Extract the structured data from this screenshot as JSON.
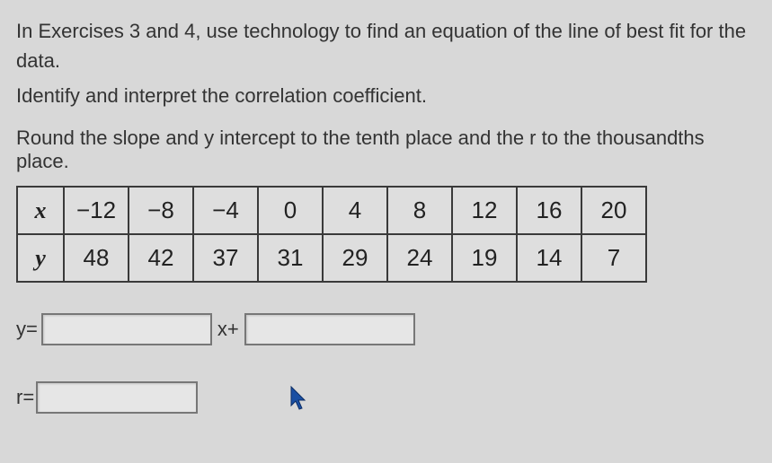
{
  "instructions": {
    "line1": "In Exercises 3 and 4, use technology to find an equation of the line of best fit for the data.",
    "line2": "Identify and interpret the correlation coefficient.",
    "rounding": "Round the slope and y intercept to the tenth place and the r to the thousandths place."
  },
  "table": {
    "rowLabels": {
      "x": "x",
      "y": "y"
    },
    "x": [
      "−12",
      "−8",
      "−4",
      "0",
      "4",
      "8",
      "12",
      "16",
      "20"
    ],
    "y": [
      "48",
      "42",
      "37",
      "31",
      "29",
      "24",
      "19",
      "14",
      "7"
    ]
  },
  "equation": {
    "yPrefix": "y=",
    "mid": "x+",
    "slopeValue": "",
    "interceptValue": ""
  },
  "correlation": {
    "prefix": "r=",
    "value": ""
  },
  "chart_data": {
    "type": "table",
    "title": "Data set for line of best fit",
    "columns": [
      "x",
      "y"
    ],
    "rows": [
      {
        "x": -12,
        "y": 48
      },
      {
        "x": -8,
        "y": 42
      },
      {
        "x": -4,
        "y": 37
      },
      {
        "x": 0,
        "y": 31
      },
      {
        "x": 4,
        "y": 29
      },
      {
        "x": 8,
        "y": 24
      },
      {
        "x": 12,
        "y": 19
      },
      {
        "x": 16,
        "y": 14
      },
      {
        "x": 20,
        "y": 7
      }
    ]
  }
}
